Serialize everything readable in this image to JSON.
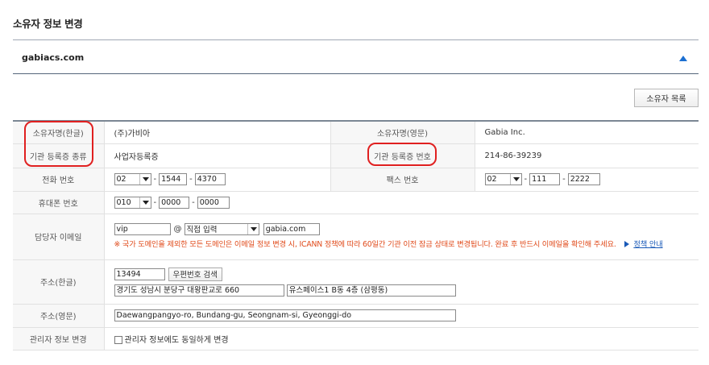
{
  "page_title": "소유자 정보 변경",
  "domain": "gabiacs.com",
  "owner_list_button": "소유자 목록",
  "rows": {
    "owner_kr_label": "소유자명(한글)",
    "owner_kr_value": "(주)가비아",
    "owner_en_label": "소유자명(영문)",
    "owner_en_value": "Gabia Inc.",
    "cert_type_label": "기관 등록증 종류",
    "cert_type_value": "사업자등록증",
    "cert_no_label": "기관 등록증 번호",
    "cert_no_value": "214-86-39239",
    "phone_label": "전화 번호",
    "phone": {
      "area": "02",
      "mid": "1544",
      "last": "4370"
    },
    "fax_label": "팩스 번호",
    "fax": {
      "area": "02",
      "mid": "111",
      "last": "2222"
    },
    "mobile_label": "휴대폰 번호",
    "mobile": {
      "area": "010",
      "mid": "0000",
      "last": "0000"
    },
    "email_label": "담당자 이메일",
    "email": {
      "id": "vip",
      "at": "@",
      "domain_select": "직접 입력",
      "domain": "gabia.com"
    },
    "email_notice": "※ 국가 도메인을 제외한 모든 도메인은 이메일 정보 변경 시, ICANN 정책에 따라 60일간 기관 이전 잠금 상태로 변경됩니다. 완료 후 반드시 이메일을 확인해 주세요.",
    "policy_link": "정책 안내",
    "addr_kr_label": "주소(한글)",
    "zip": "13494",
    "zip_button": "우편번호 검색",
    "addr_kr_1": "경기도 성남시 분당구 대왕판교로 660",
    "addr_kr_2": "유스페이스1 B동 4층 (삼평동)",
    "addr_en_label": "주소(영문)",
    "addr_en": "Daewangpangyo-ro, Bundang-gu, Seongnam-si, Gyeonggi-do",
    "manager_label": "관리자 정보 변경",
    "manager_checkbox_label": "관리자 정보에도 동일하게 변경"
  },
  "colors": {
    "accent": "#1c6fd1",
    "notice": "#e04a1a",
    "highlight": "#e02020"
  }
}
